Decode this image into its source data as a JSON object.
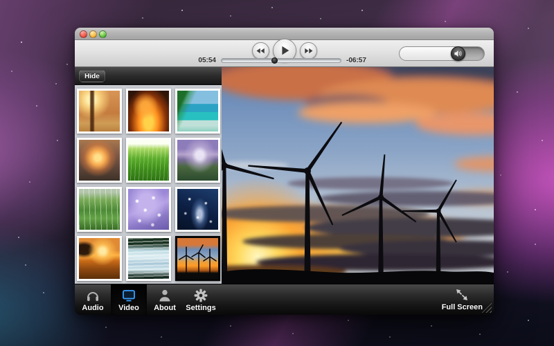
{
  "window": {
    "controls": [
      "close",
      "minimize",
      "zoom"
    ]
  },
  "playback": {
    "elapsed": "05:54",
    "remaining": "-06:57",
    "progress_percent": 45,
    "transport": [
      "rewind",
      "play",
      "fast-forward"
    ]
  },
  "volume": {
    "percent": 70,
    "icon": "speaker"
  },
  "sidebar": {
    "hide_button": "Hide",
    "thumbnails": [
      {
        "name": "autumn-trees",
        "selected": false
      },
      {
        "name": "fireplace",
        "selected": false
      },
      {
        "name": "tropical-beach",
        "selected": false
      },
      {
        "name": "sunset-clouds",
        "selected": false
      },
      {
        "name": "green-grass",
        "selected": false
      },
      {
        "name": "mountain-lake",
        "selected": false
      },
      {
        "name": "forest-meadow",
        "selected": false
      },
      {
        "name": "purple-raindrops",
        "selected": false
      },
      {
        "name": "starry-sky",
        "selected": false
      },
      {
        "name": "lake-sunset",
        "selected": false
      },
      {
        "name": "waterfall",
        "selected": false
      },
      {
        "name": "wind-turbines",
        "selected": true
      }
    ]
  },
  "video": {
    "description": "wind turbines silhouetted against sunset sky"
  },
  "toolbar": {
    "items": [
      {
        "label": "Audio",
        "icon": "headphones-icon",
        "selected": false
      },
      {
        "label": "Video",
        "icon": "display-icon",
        "selected": true
      },
      {
        "label": "About",
        "icon": "person-icon",
        "selected": false
      },
      {
        "label": "Settings",
        "icon": "gear-icon",
        "selected": false
      }
    ],
    "fullscreen_label": "Full Screen"
  },
  "colors": {
    "accent_blue": "#38a0ff",
    "sidebar_bg": "#c9cdd2",
    "toolbar_dark": "#151515",
    "selected_thumb_border": "#060606"
  }
}
